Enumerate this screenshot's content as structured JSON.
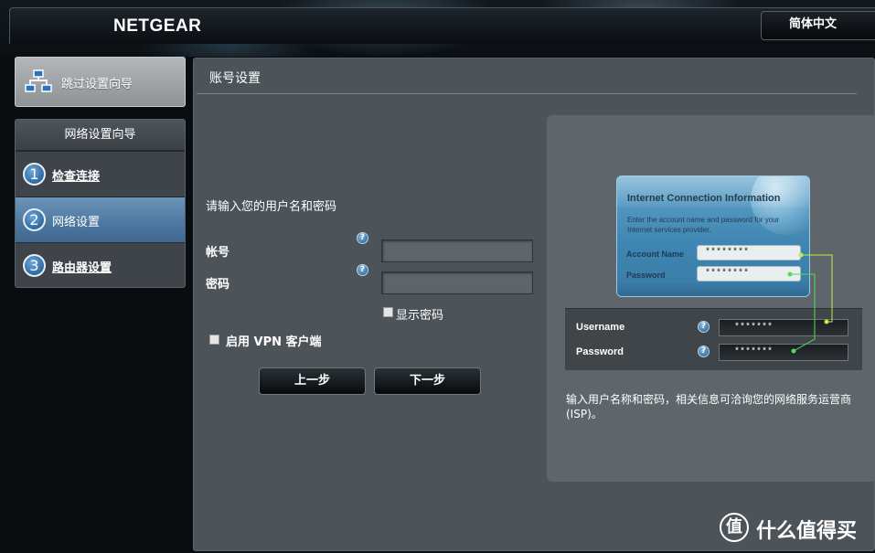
{
  "header": {
    "brand": "NETGEAR",
    "language": "简体中文"
  },
  "sidebar": {
    "skip_wizard": "跳过设置向导",
    "wizard_title": "网络设置向导",
    "steps": [
      {
        "num": "1",
        "label": "检查连接"
      },
      {
        "num": "2",
        "label": "网络设置"
      },
      {
        "num": "3",
        "label": "路由器设置"
      }
    ],
    "active_step": 2
  },
  "main": {
    "title": "账号设置",
    "prompt": "请输入您的用户名和密码",
    "account_label": "帐号",
    "password_label": "密码",
    "account_value": "",
    "password_value": "",
    "show_password": "显示密码",
    "show_password_checked": false,
    "vpn_label": "启用 VPN 客户端",
    "vpn_checked": false,
    "back_button": "上一步",
    "next_button": "下一步",
    "help_glyph": "?"
  },
  "illustration": {
    "card_title": "Internet Connection Information",
    "card_desc": "Enter the account name and password for your Internet services provider.",
    "card_account_label": "Account Name",
    "card_password_label": "Password",
    "card_account_value": "********",
    "card_password_value": "********",
    "username_label": "Username",
    "password_label": "Password",
    "username_value": "*******",
    "password_value": "*******",
    "caption": "输入用户名称和密码，相关信息可洽询您的网络服务运营商 (ISP)。"
  },
  "watermark": {
    "symbol": "值",
    "text": "什么值得买"
  },
  "colors": {
    "active_step": "#4b77a0",
    "panel": "#4d5459",
    "connector_line": "#c6e84a"
  }
}
